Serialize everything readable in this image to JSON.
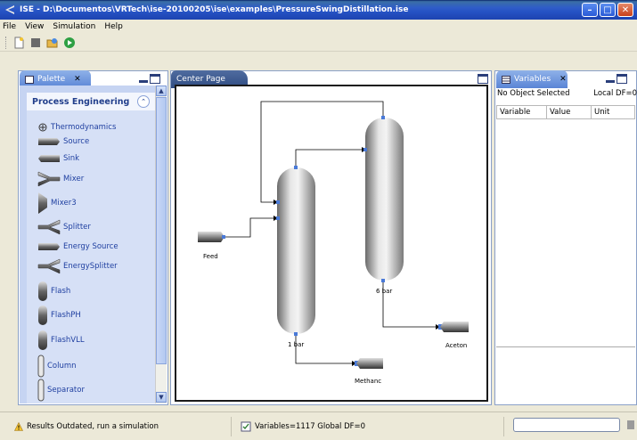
{
  "window": {
    "title": "ISE - D:\\Documentos\\VRTech\\ise-20100205\\ise\\examples\\PressureSwingDistillation.ise",
    "buttons": [
      "minimize",
      "maximize",
      "close"
    ]
  },
  "menu": {
    "items": [
      "File",
      "View",
      "Simulation",
      "Help"
    ]
  },
  "toolbar": {
    "icons": [
      "new-file-icon",
      "stop-icon",
      "open-folder-icon",
      "run-icon"
    ]
  },
  "palette": {
    "tab_label": "Palette",
    "section_title": "Process Engineering",
    "items": [
      {
        "label": "Thermodynamics",
        "icon": "thermodynamics-icon"
      },
      {
        "label": "Source",
        "icon": "source-icon"
      },
      {
        "label": "Sink",
        "icon": "sink-icon"
      },
      {
        "label": "Mixer",
        "icon": "mixer-icon"
      },
      {
        "label": "Mixer3",
        "icon": "mixer3-icon"
      },
      {
        "label": "Splitter",
        "icon": "splitter-icon"
      },
      {
        "label": "Energy Source",
        "icon": "energy-source-icon"
      },
      {
        "label": "EnergySplitter",
        "icon": "energy-splitter-icon"
      },
      {
        "label": "Flash",
        "icon": "flash-icon"
      },
      {
        "label": "FlashPH",
        "icon": "flashph-icon"
      },
      {
        "label": "FlashVLL",
        "icon": "flashvll-icon"
      },
      {
        "label": "Column",
        "icon": "column-icon"
      },
      {
        "label": "Separator",
        "icon": "separator-icon"
      }
    ]
  },
  "center": {
    "tab_label": "Center Page",
    "diagram": {
      "feed_label": "Feed",
      "column1_label": "1 bar",
      "column2_label": "6 bar",
      "product1_label": "Methanc",
      "product2_label": "Aceton"
    }
  },
  "variables": {
    "tab_label": "Variables",
    "selection_text": "No Object Selected",
    "local_df": "Local DF=0",
    "columns": [
      "Variable",
      "Value",
      "Unit"
    ]
  },
  "status": {
    "message": "Results Outdated, run a simulation",
    "variables_info": "Variables=1117 Global DF=0"
  }
}
